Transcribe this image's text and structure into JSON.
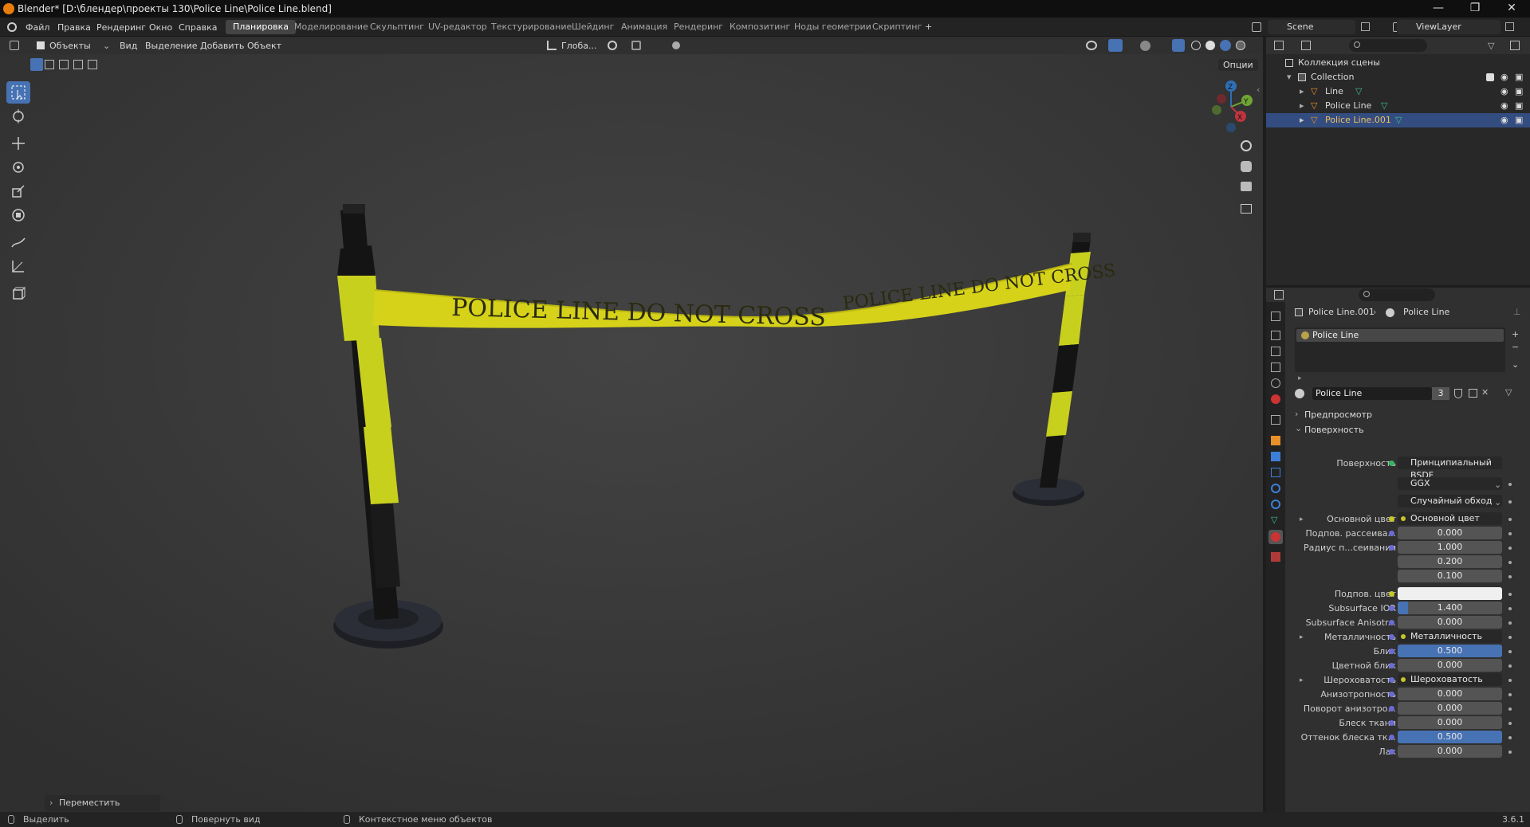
{
  "titlebar": {
    "title": "Blender* [D:\\блендер\\проекты 130\\Police Line\\Police Line.blend]",
    "minimize": "—",
    "restore": "❐",
    "close": "✕"
  },
  "menu": {
    "items": [
      "Файл",
      "Правка",
      "Рендеринг",
      "Окно",
      "Справка"
    ],
    "workspaces": [
      "Планировка",
      "Моделирование",
      "Скульптинг",
      "UV-редактор",
      "Текстурирование",
      "Шейдинг",
      "Анимация",
      "Рендеринг",
      "Композитинг",
      "Ноды геометрии",
      "Скриптинг"
    ],
    "active_workspace": "Планировка",
    "add_workspace": "+",
    "scene": "Scene",
    "view_layer": "ViewLayer"
  },
  "viewport": {
    "mode": "Объекты",
    "menu": [
      "Вид",
      "Выделение",
      "Добавить",
      "Объект"
    ],
    "orientation": "Глоба...",
    "options": "Опции",
    "tape_text_front": "POLICE LINE DO NOT CROSS",
    "tape_text_back": "POLICE LINE DO NOT CROSS",
    "gizmo_axes": {
      "z": "Z",
      "y": "Y",
      "x": "X"
    },
    "last_operator": "Переместить",
    "colors": {
      "background": "#3b3b3b",
      "tape": "#d6d21a",
      "post_yellow": "#c8d01e",
      "post_black": "#141414"
    }
  },
  "toolbar": {
    "tools": [
      "select-box",
      "cursor",
      "move",
      "rotate",
      "scale",
      "transform",
      "annotate",
      "measure",
      "add-cube"
    ]
  },
  "outliner": {
    "search_placeholder": "",
    "root": "Коллекция сцены",
    "collection": "Collection",
    "objects": [
      {
        "name": "Line",
        "selected": false
      },
      {
        "name": "Police Line",
        "selected": false
      },
      {
        "name": "Police Line.001",
        "selected": true
      }
    ]
  },
  "properties": {
    "breadcrumb_object": "Police Line.001",
    "breadcrumb_material": "Police Line",
    "slot": "Police Line",
    "material_name": "Police Line",
    "users": "3",
    "panels": {
      "preview": "Предпросмотр",
      "surface": "Поверхность"
    },
    "surface_label": "Поверхность",
    "surface_value": "Принципиальный BSDF",
    "distribution": "GGX",
    "subsurface_method": "Случайный обход",
    "rows": [
      {
        "label": "Основной цвет",
        "value": "Основной цвет",
        "type": "link",
        "dot": "y"
      },
      {
        "label": "Подпов. рассеива...",
        "value": "0.000",
        "type": "num",
        "dot": "b"
      },
      {
        "label": "Радиус п...сеивания",
        "value": "1.000",
        "type": "num",
        "dot": "b"
      },
      {
        "label": "",
        "value": "0.200",
        "type": "num",
        "dot": ""
      },
      {
        "label": "",
        "value": "0.100",
        "type": "num",
        "dot": ""
      },
      {
        "label": "Подпов. цвет",
        "value": "",
        "type": "color",
        "dot": "y"
      },
      {
        "label": "Subsurface IOR",
        "value": "1.400",
        "type": "num",
        "dot": "b"
      },
      {
        "label": "Subsurface Anisotr...",
        "value": "0.000",
        "type": "num",
        "dot": "b"
      },
      {
        "label": "Металличность",
        "value": "Металличность",
        "type": "link",
        "dot": "b"
      },
      {
        "label": "Блик",
        "value": "0.500",
        "type": "blue",
        "dot": "b"
      },
      {
        "label": "Цветной блик",
        "value": "0.000",
        "type": "num",
        "dot": "b"
      },
      {
        "label": "Шероховатость",
        "value": "Шероховатость",
        "type": "link",
        "dot": "b"
      },
      {
        "label": "Анизотропность",
        "value": "0.000",
        "type": "num",
        "dot": "b"
      },
      {
        "label": "Поворот анизотро...",
        "value": "0.000",
        "type": "num",
        "dot": "b"
      },
      {
        "label": "Блеск ткани",
        "value": "0.000",
        "type": "num",
        "dot": "b"
      },
      {
        "label": "Оттенок блеска тк...",
        "value": "0.500",
        "type": "blue",
        "dot": "b"
      },
      {
        "label": "Лак",
        "value": "0.000",
        "type": "num",
        "dot": "b"
      }
    ]
  },
  "statusbar": {
    "select": "Выделить",
    "rotate_view": "Повернуть вид",
    "context_menu": "Контекстное меню объектов",
    "version": "3.6.1"
  }
}
